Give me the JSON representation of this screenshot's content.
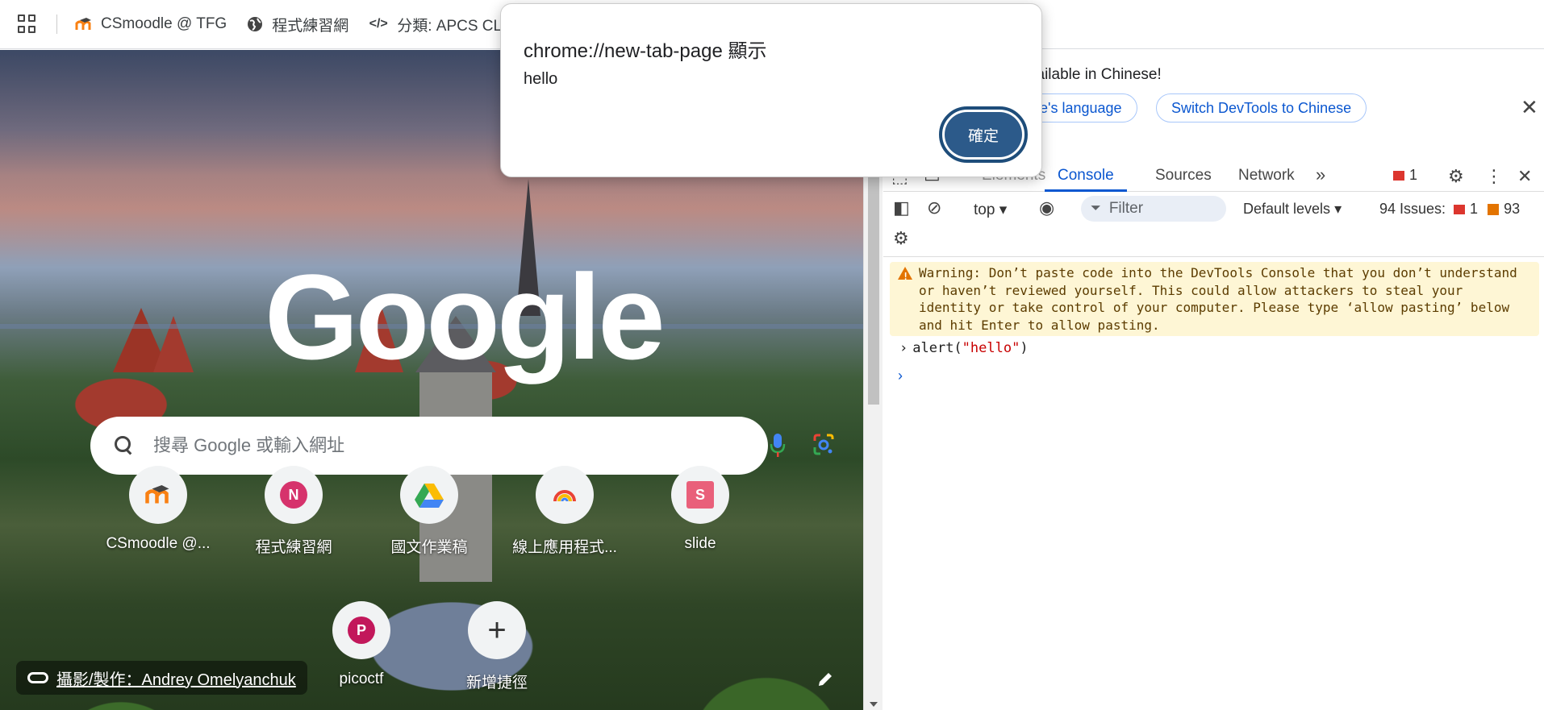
{
  "bookmarks": {
    "items": [
      {
        "label": "CSmoodle @ TFG"
      },
      {
        "label": "程式練習網"
      },
      {
        "label": "分類: APCS CLASS"
      }
    ]
  },
  "ntp": {
    "logo_text": "Google",
    "search_placeholder": "搜尋 Google 或輸入網址",
    "shortcuts": [
      {
        "label": "CSmoodle @...",
        "icon": "moodle-icon"
      },
      {
        "label": "程式練習網",
        "icon": "N",
        "color": "#d6336c"
      },
      {
        "label": "國文作業稿",
        "icon": "google-drive-icon"
      },
      {
        "label": "線上應用程式...",
        "icon": "rainbow-icon"
      },
      {
        "label": "slide",
        "icon": "S",
        "color": "#e9607a"
      },
      {
        "label": "picoctf",
        "icon": "P",
        "color": "#c2185b"
      },
      {
        "label": "新增捷徑",
        "icon": "plus-icon"
      }
    ],
    "attribution": "攝影/製作：Andrey Omelyanchuk"
  },
  "dialog": {
    "title": "chrome://new-tab-page 顯示",
    "message": "hello",
    "ok_label": "確定"
  },
  "devtools": {
    "banner": {
      "text": "vailable in Chinese!",
      "button1": "me's language",
      "button2": "Switch DevTools to Chinese"
    },
    "tabs": [
      "Elements",
      "Console",
      "Sources",
      "Network"
    ],
    "active_tab": "Console",
    "error_count": "1",
    "toolbar": {
      "context": "top",
      "filter_placeholder": "Filter",
      "levels": "Default levels",
      "issues_label": "94 Issues:",
      "issues_errors": "1",
      "issues_warnings": "93"
    },
    "console": {
      "warning": "Warning: Don’t paste code into the DevTools Console that you don’t understand or haven’t reviewed yourself. This could allow attackers to steal your identity or take control of your computer. Please type ‘allow pasting’ below and hit Enter to allow pasting.",
      "command_prefix": "alert(",
      "command_arg": "\"hello\"",
      "command_suffix": ")"
    }
  }
}
